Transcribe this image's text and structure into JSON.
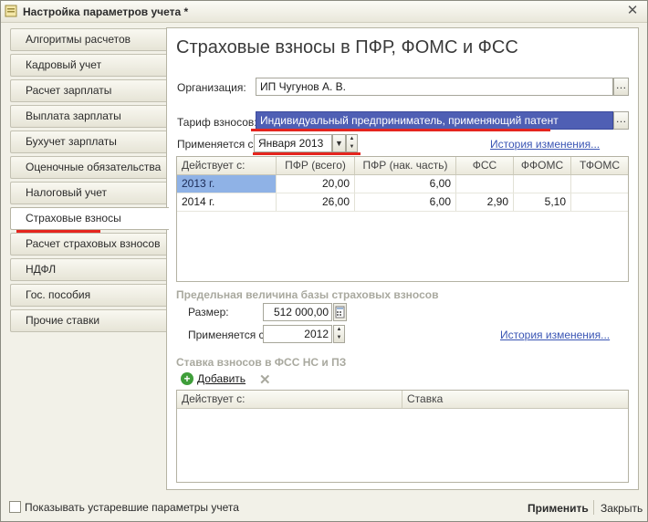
{
  "window": {
    "title": "Настройка параметров учета *"
  },
  "nav": {
    "items": [
      {
        "label": "Алгоритмы расчетов"
      },
      {
        "label": "Кадровый учет"
      },
      {
        "label": "Расчет зарплаты"
      },
      {
        "label": "Выплата зарплаты"
      },
      {
        "label": "Бухучет зарплаты"
      },
      {
        "label": "Оценочные обязательства"
      },
      {
        "label": "Налоговый учет"
      },
      {
        "label": "Страховые взносы",
        "active": true
      },
      {
        "label": "Расчет страховых взносов"
      },
      {
        "label": "НДФЛ"
      },
      {
        "label": "Гос. пособия"
      },
      {
        "label": "Прочие ставки"
      }
    ]
  },
  "main": {
    "heading": "Страховые взносы в ПФР, ФОМС и ФСС",
    "organization": {
      "label": "Организация:",
      "value": "ИП Чугунов А. В."
    },
    "tariff": {
      "label": "Тариф взносов:",
      "value": "Индивидуальный предприниматель, применяющий патент"
    },
    "applies_from": {
      "label": "Применяется с:",
      "value": "Января  2013"
    },
    "history_link": "История изменения...",
    "rates_table": {
      "columns": [
        "Действует с:",
        "ПФР (всего)",
        "ПФР (нак. часть)",
        "ФСС",
        "ФФОМС",
        "ТФОМС"
      ],
      "rows": [
        [
          "2013 г.",
          "20,00",
          "6,00",
          "",
          "",
          ""
        ],
        [
          "2014 г.",
          "26,00",
          "6,00",
          "2,90",
          "5,10",
          ""
        ]
      ]
    },
    "base_limit": {
      "title": "Предельная величина базы страховых взносов",
      "size_label": "Размер:",
      "size_value": "512 000,00",
      "applies_label": "Применяется с:",
      "applies_value": "2012",
      "history_link": "История изменения..."
    },
    "fss_rate": {
      "title": "Ставка взносов в ФСС НС и ПЗ",
      "add_label": "Добавить",
      "columns": [
        "Действует с:",
        "Ставка"
      ]
    }
  },
  "footer": {
    "show_obsolete_label": "Показывать устаревшие параметры учета",
    "apply_label": "Применить",
    "close_label": "Закрыть"
  },
  "colors": {
    "highlight": "#4f5fb4",
    "annotation": "#e5251e",
    "link": "#3a55b4"
  }
}
